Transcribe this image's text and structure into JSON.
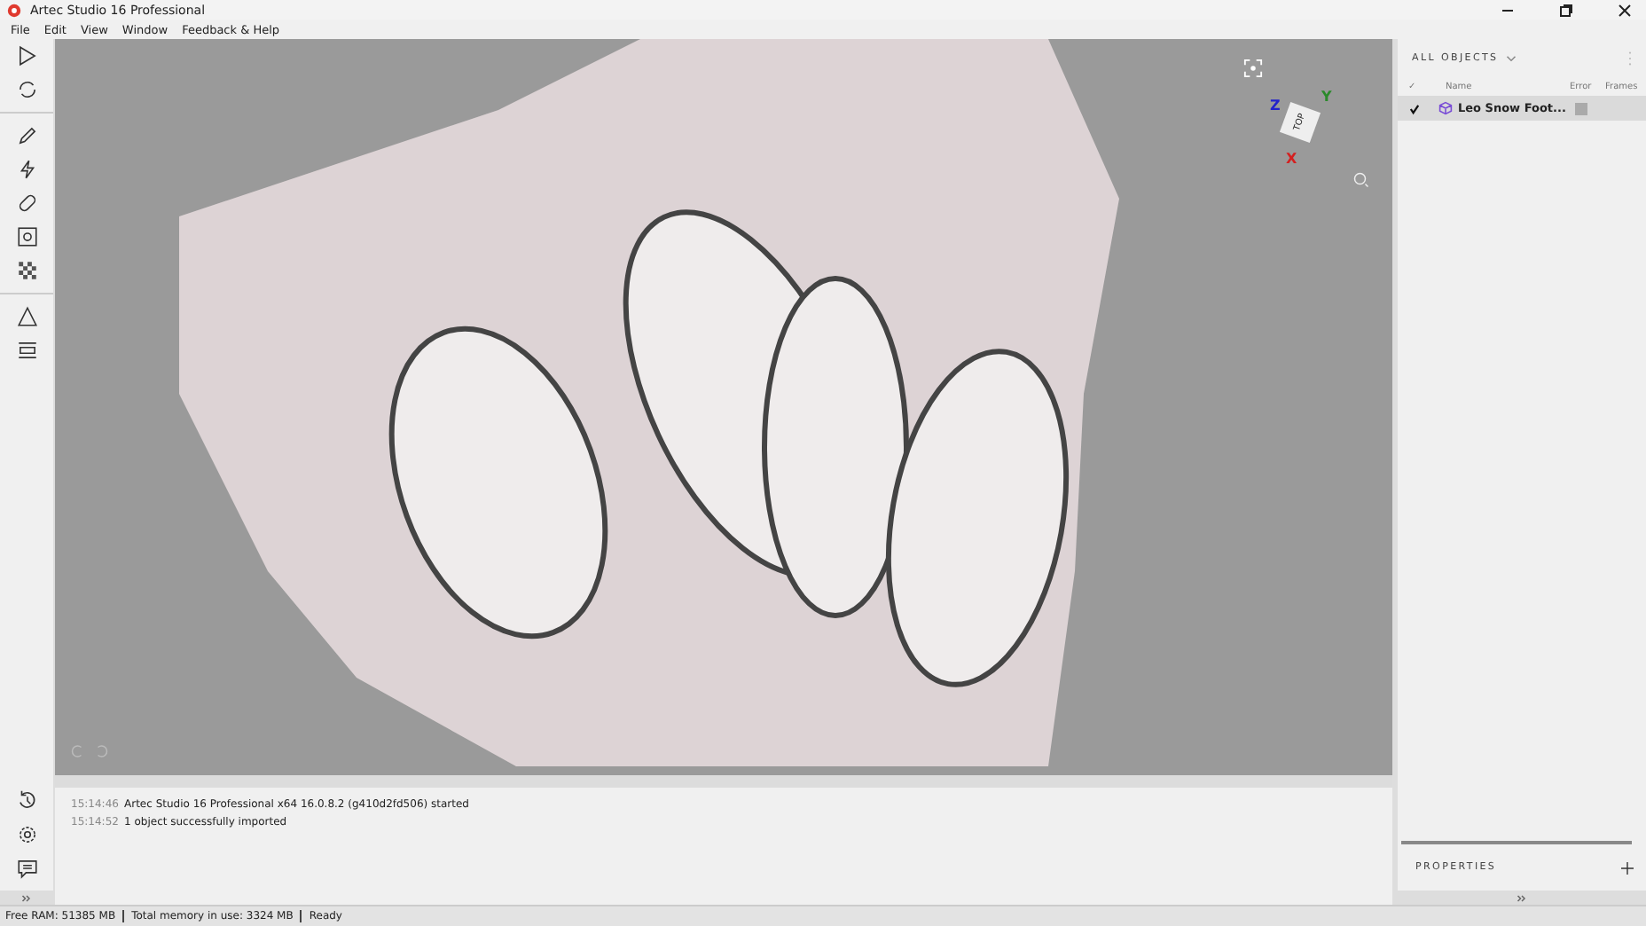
{
  "window": {
    "title": "Artec Studio 16 Professional"
  },
  "menu": [
    "File",
    "Edit",
    "View",
    "Window",
    "Feedback & Help"
  ],
  "viewport": {
    "axis_labels": [
      "Z",
      "Y",
      "X"
    ],
    "cube_face": "TOP"
  },
  "log": [
    {
      "time": "15:14:46",
      "message": "Artec Studio 16 Professional x64 16.0.8.2 (g410d2fd506) started"
    },
    {
      "time": "15:14:52",
      "message": "1 object successfully imported"
    }
  ],
  "objects_panel": {
    "title": "ALL OBJECTS",
    "columns": [
      "✓",
      "Name",
      "Error",
      "Frames"
    ],
    "rows": [
      {
        "name": "Leo Snow Foot...",
        "checked": true,
        "selected": true
      }
    ]
  },
  "properties_panel": {
    "title": "PROPERTIES"
  },
  "status_bar": [
    "Free RAM: 51385 MB",
    "Total memory in use: 3324 MB",
    "Ready"
  ]
}
